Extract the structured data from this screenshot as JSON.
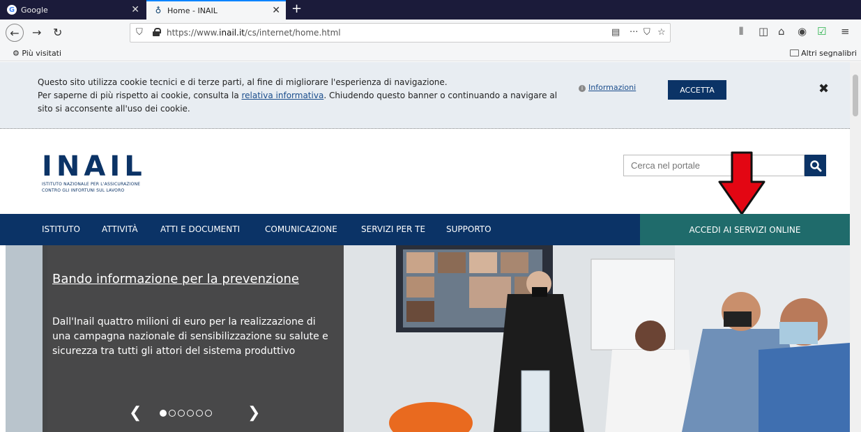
{
  "browser": {
    "tabs": [
      {
        "label": "Google",
        "favicon": "G"
      },
      {
        "label": "Home - INAIL",
        "favicon": "♁"
      }
    ],
    "url_prefix": "https://www.",
    "url_domain": "inail.it",
    "url_suffix": "/cs/internet/home.html",
    "bookmarks_left": "Più visitati",
    "bookmarks_right": "Altri segnalibri"
  },
  "cookie": {
    "line1": "Questo sito utilizza cookie tecnici e di terze parti, al fine di migliorare l'esperienza di navigazione.",
    "line2_pre": "Per saperne di più rispetto ai cookie, consulta la ",
    "line2_link": "relativa informativa",
    "line2_post": ". Chiudendo questo banner o continuando a navigare al",
    "line3": "sito si acconsente all'uso dei cookie.",
    "info_label": "Informazioni",
    "accept_label": "ACCETTA",
    "close_symbol": "✖"
  },
  "header": {
    "logo_text": "INAIL",
    "logo_sub_1": "ISTITUTO NAZIONALE PER L'ASSICURAZIONE",
    "logo_sub_2": "CONTRO GLI INFORTUNI SUL LAVORO",
    "search_placeholder": "Cerca nel portale"
  },
  "nav": {
    "items": [
      "ISTITUTO",
      "ATTIVITÀ",
      "ATTI E DOCUMENTI",
      "COMUNICAZIONE",
      "SERVIZI PER TE",
      "SUPPORTO"
    ],
    "online": "ACCEDI AI SERVIZI ONLINE"
  },
  "hero": {
    "title": "Bando informazione per la prevenzione",
    "text": "Dall'Inail quattro milioni di euro per la realizzazione di una campagna nazionale di sensibilizzazione su salute e sicurezza tra tutti gli attori del sistema produttivo",
    "slide_count": 6,
    "active_slide": 1
  },
  "colors": {
    "brand_navy": "#0b3366",
    "online_teal": "#1f6b6b",
    "arrow_red": "#e30613"
  }
}
